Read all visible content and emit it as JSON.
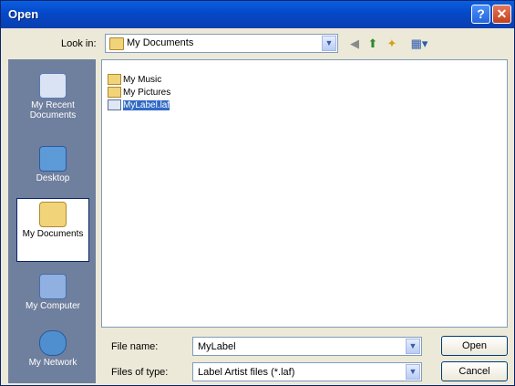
{
  "window": {
    "title": "Open"
  },
  "titlebar": {
    "help_label": "?",
    "close_label": "✕"
  },
  "lookin": {
    "label": "Look in:",
    "value": "My Documents"
  },
  "toolbar": {
    "back": "◀",
    "up": "⬆",
    "new_folder": "✦",
    "views": "▦▾"
  },
  "places": [
    {
      "label": "My Recent Documents"
    },
    {
      "label": "Desktop"
    },
    {
      "label": "My Documents"
    },
    {
      "label": "My Computer"
    },
    {
      "label": "My Network"
    }
  ],
  "files": [
    {
      "name": "My Music"
    },
    {
      "name": "My Pictures"
    },
    {
      "name": "MyLabel.laf"
    }
  ],
  "filename": {
    "label": "File name:",
    "value": "MyLabel"
  },
  "filetype": {
    "label": "Files of type:",
    "value": "Label Artist files (*.laf)"
  },
  "buttons": {
    "open": "Open",
    "cancel": "Cancel"
  },
  "colors": {
    "titlebar": "#0548c8",
    "places_bar": "#6f7f9e",
    "selection": "#316ac5",
    "folder": "#f1d37a"
  }
}
